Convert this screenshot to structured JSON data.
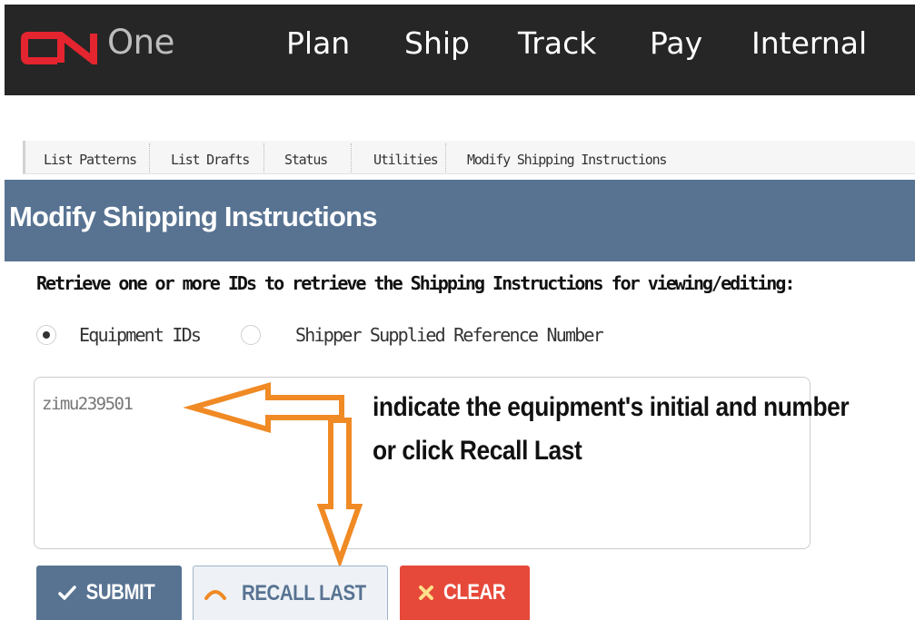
{
  "header": {
    "logo_text": "CN",
    "app_name": "One",
    "nav": [
      "Plan",
      "Ship",
      "Track",
      "Pay",
      "Internal"
    ]
  },
  "tabs": [
    "List Patterns",
    "List Drafts",
    "Status",
    "Utilities",
    "Modify Shipping Instructions"
  ],
  "page": {
    "title": "Modify Shipping Instructions",
    "instruction": "Retrieve one or more IDs to retrieve the Shipping Instructions for viewing/editing:"
  },
  "options": {
    "equipment_ids": "Equipment IDs",
    "shipper_ref": "Shipper Supplied Reference Number",
    "selected": "equipment_ids"
  },
  "input": {
    "value": "zimu239501"
  },
  "annotation": {
    "line1": "indicate the equipment's initial and number",
    "line2": "or click Recall Last"
  },
  "buttons": {
    "submit": "SUBMIT",
    "recall": "RECALL LAST",
    "clear": "CLEAR"
  },
  "colors": {
    "brand_red": "#e4252f",
    "header_bg": "#262626",
    "title_bar": "#587392",
    "clear_red": "#e6493a",
    "arrow_orange": "#f08a24"
  },
  "icons": {
    "submit": "checkmark-icon",
    "recall": "arc-icon",
    "clear": "x-icon"
  }
}
